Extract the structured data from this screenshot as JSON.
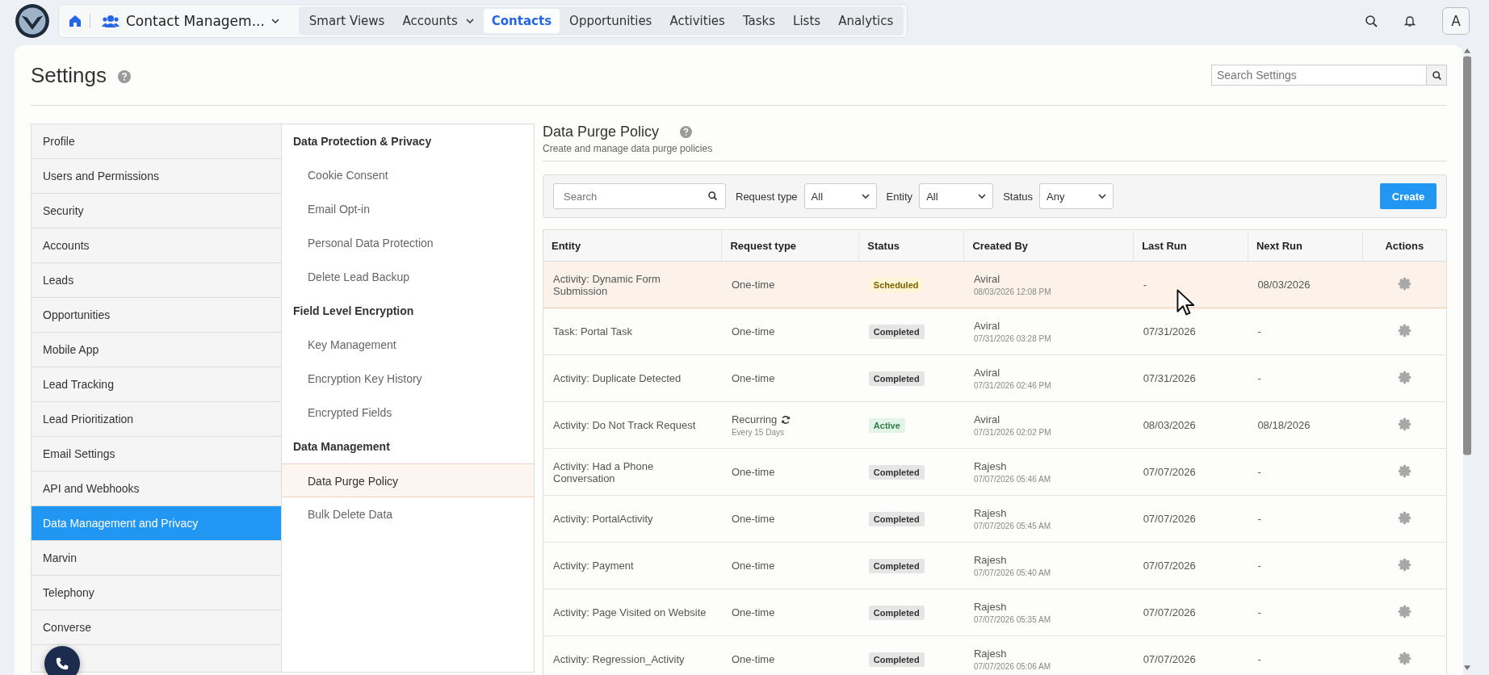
{
  "app": {
    "workspace": "Contact Managem...",
    "avatar": "A",
    "tabs": [
      {
        "label": "Smart Views",
        "selected": false,
        "dropdown": false
      },
      {
        "label": "Accounts",
        "selected": false,
        "dropdown": true
      },
      {
        "label": "Contacts",
        "selected": true,
        "dropdown": false
      },
      {
        "label": "Opportunities",
        "selected": false,
        "dropdown": false
      },
      {
        "label": "Activities",
        "selected": false,
        "dropdown": false
      },
      {
        "label": "Tasks",
        "selected": false,
        "dropdown": false
      },
      {
        "label": "Lists",
        "selected": false,
        "dropdown": false
      },
      {
        "label": "Analytics",
        "selected": false,
        "dropdown": false
      }
    ]
  },
  "settings": {
    "title": "Settings",
    "search_placeholder": "Search Settings"
  },
  "nav": [
    {
      "label": "Profile",
      "selected": false
    },
    {
      "label": "Users and Permissions",
      "selected": false
    },
    {
      "label": "Security",
      "selected": false
    },
    {
      "label": "Accounts",
      "selected": false
    },
    {
      "label": "Leads",
      "selected": false
    },
    {
      "label": "Opportunities",
      "selected": false
    },
    {
      "label": "Mobile App",
      "selected": false
    },
    {
      "label": "Lead Tracking",
      "selected": false
    },
    {
      "label": "Lead Prioritization",
      "selected": false
    },
    {
      "label": "Email Settings",
      "selected": false
    },
    {
      "label": "API and Webhooks",
      "selected": false
    },
    {
      "label": "Data Management and Privacy",
      "selected": true
    },
    {
      "label": "Marvin",
      "selected": false
    },
    {
      "label": "Telephony",
      "selected": false
    },
    {
      "label": "Converse",
      "selected": false
    }
  ],
  "subnav": [
    {
      "heading": "Data Protection & Privacy",
      "items": [
        {
          "label": "Cookie Consent",
          "selected": false
        },
        {
          "label": "Email Opt-in",
          "selected": false
        },
        {
          "label": "Personal Data Protection",
          "selected": false
        },
        {
          "label": "Delete Lead Backup",
          "selected": false
        }
      ]
    },
    {
      "heading": "Field Level Encryption",
      "items": [
        {
          "label": "Key Management",
          "selected": false
        },
        {
          "label": "Encryption Key History",
          "selected": false
        },
        {
          "label": "Encrypted Fields",
          "selected": false
        }
      ]
    },
    {
      "heading": "Data Management",
      "items": [
        {
          "label": "Data Purge Policy",
          "selected": true
        },
        {
          "label": "Bulk Delete Data",
          "selected": false
        }
      ]
    }
  ],
  "panel": {
    "title": "Data Purge Policy",
    "subtitle": "Create and manage data purge policies",
    "search_placeholder": "Search",
    "filters": [
      {
        "label": "Request type",
        "value": "All"
      },
      {
        "label": "Entity",
        "value": "All"
      },
      {
        "label": "Status",
        "value": "Any"
      }
    ],
    "create": "Create",
    "columns": [
      "Entity",
      "Request type",
      "Status",
      "Created By",
      "Last Run",
      "Next Run",
      "Actions"
    ],
    "rows": [
      {
        "entity": "Activity: Dynamic Form Submission",
        "request_type": "One-time",
        "recurring": false,
        "status": "Scheduled",
        "kind": "scheduled",
        "created_by": "Aviral",
        "created_at": "08/03/2026 12:08 PM",
        "last_run": "-",
        "next_run": "08/03/2026",
        "highlighted": true
      },
      {
        "entity": "Task: Portal Task",
        "request_type": "One-time",
        "recurring": false,
        "status": "Completed",
        "kind": "completed",
        "created_by": "Aviral",
        "created_at": "07/31/2026 03:28 PM",
        "last_run": "07/31/2026",
        "next_run": "-",
        "highlighted": false
      },
      {
        "entity": "Activity: Duplicate Detected",
        "request_type": "One-time",
        "recurring": false,
        "status": "Completed",
        "kind": "completed",
        "created_by": "Aviral",
        "created_at": "07/31/2026 02:46 PM",
        "last_run": "07/31/2026",
        "next_run": "-",
        "highlighted": false
      },
      {
        "entity": "Activity: Do Not Track Request",
        "request_type": "Recurring",
        "recurring": true,
        "schedule": "Every 15 Days",
        "status": "Active",
        "kind": "active",
        "created_by": "Aviral",
        "created_at": "07/31/2026 02:02 PM",
        "last_run": "08/03/2026",
        "next_run": "08/18/2026",
        "highlighted": false
      },
      {
        "entity": "Activity: Had a Phone Conversation",
        "request_type": "One-time",
        "recurring": false,
        "status": "Completed",
        "kind": "completed",
        "created_by": "Rajesh",
        "created_at": "07/07/2026 05:46 AM",
        "last_run": "07/07/2026",
        "next_run": "-",
        "highlighted": false
      },
      {
        "entity": "Activity: PortalActivity",
        "request_type": "One-time",
        "recurring": false,
        "status": "Completed",
        "kind": "completed",
        "created_by": "Rajesh",
        "created_at": "07/07/2026 05:45 AM",
        "last_run": "07/07/2026",
        "next_run": "-",
        "highlighted": false
      },
      {
        "entity": "Activity: Payment",
        "request_type": "One-time",
        "recurring": false,
        "status": "Completed",
        "kind": "completed",
        "created_by": "Rajesh",
        "created_at": "07/07/2026 05:40 AM",
        "last_run": "07/07/2026",
        "next_run": "-",
        "highlighted": false
      },
      {
        "entity": "Activity: Page Visited on Website",
        "request_type": "One-time",
        "recurring": false,
        "status": "Completed",
        "kind": "completed",
        "created_by": "Rajesh",
        "created_at": "07/07/2026 05:35 AM",
        "last_run": "07/07/2026",
        "next_run": "-",
        "highlighted": false
      },
      {
        "entity": "Activity: Regression_Activity",
        "request_type": "One-time",
        "recurring": false,
        "status": "Completed",
        "kind": "completed",
        "created_by": "Rajesh",
        "created_at": "07/07/2026 05:06 AM",
        "last_run": "07/07/2026",
        "next_run": "-",
        "highlighted": false
      }
    ]
  }
}
